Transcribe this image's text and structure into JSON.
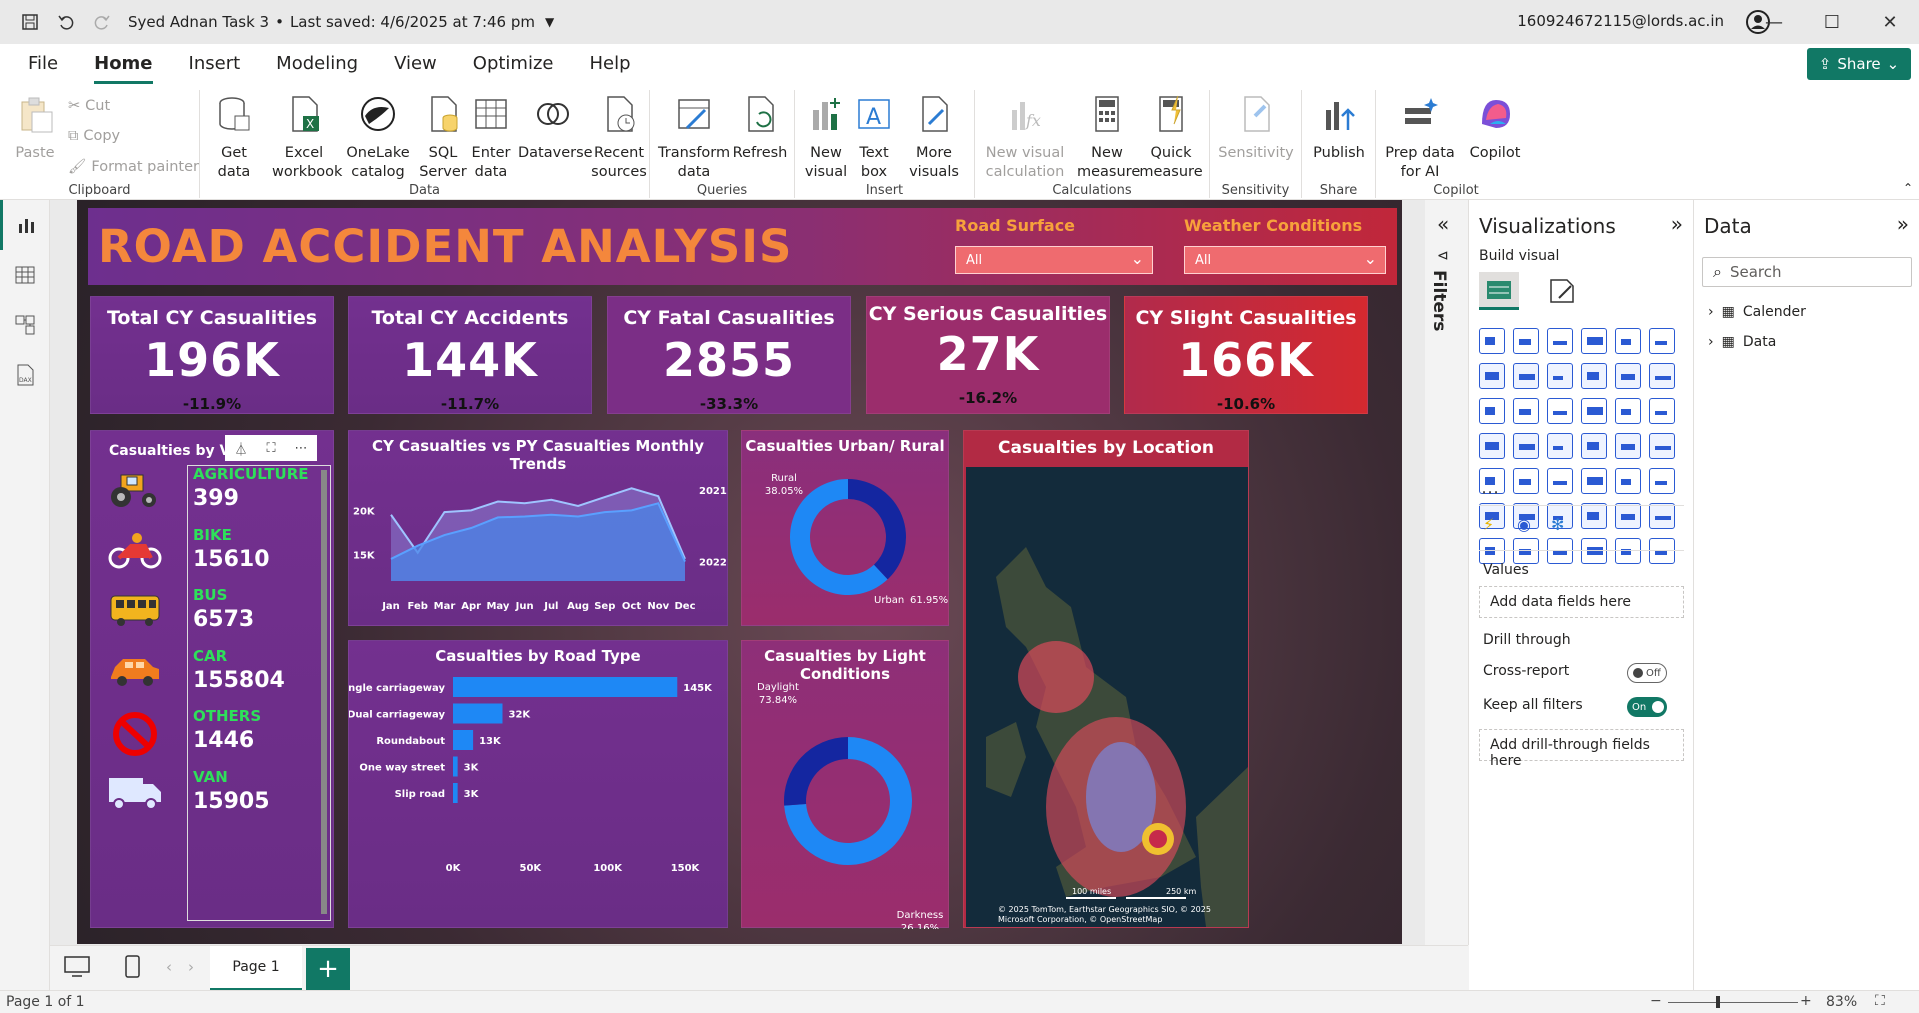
{
  "titlebar": {
    "doc_title": "Syed Adnan Task 3",
    "saved": "Last saved: 4/6/2025 at 7:46 pm",
    "account": "160924672115@lords.ac.in"
  },
  "menu": [
    "File",
    "Home",
    "Insert",
    "Modeling",
    "View",
    "Optimize",
    "Help"
  ],
  "share_label": "Share",
  "ribbon": {
    "clipboard": {
      "paste": "Paste",
      "cut": "Cut",
      "copy": "Copy",
      "format_painter": "Format painter",
      "label": "Clipboard"
    },
    "data": {
      "get_data": "Get data",
      "excel": "Excel workbook",
      "onelake": "OneLake catalog",
      "sql": "SQL Server",
      "enter": "Enter data",
      "dataverse": "Dataverse",
      "recent": "Recent sources",
      "label": "Data"
    },
    "queries": {
      "transform": "Transform data",
      "refresh": "Refresh",
      "label": "Queries"
    },
    "insert": {
      "new_visual": "New visual",
      "text_box": "Text box",
      "more_visuals": "More visuals",
      "label": "Insert"
    },
    "calculations": {
      "new_visual_calc": "New visual calculation",
      "new_measure": "New measure",
      "quick_measure": "Quick measure",
      "label": "Calculations"
    },
    "sensitivity": {
      "sensitivity": "Sensitivity",
      "label": "Sensitivity"
    },
    "share": {
      "publish": "Publish",
      "label": "Share"
    },
    "copilot": {
      "prep": "Prep data for AI",
      "copilot": "Copilot",
      "label": "Copilot"
    }
  },
  "report": {
    "title": "ROAD ACCIDENT ANALYSIS",
    "slicers": [
      {
        "label": "Road Surface",
        "value": "All"
      },
      {
        "label": "Weather Conditions",
        "value": "All"
      }
    ],
    "kpis": [
      {
        "label": "Total CY Casualities",
        "value": "196K",
        "change": "-11.9%"
      },
      {
        "label": "Total CY Accidents",
        "value": "144K",
        "change": "-11.7%"
      },
      {
        "label": "CY Fatal Casualities",
        "value": "2855",
        "change": "-33.3%"
      },
      {
        "label": "CY Serious Casualities",
        "value": "27K",
        "change": "-16.2%"
      },
      {
        "label": "CY Slight Casualities",
        "value": "166K",
        "change": "-10.6%"
      }
    ],
    "vehicles": {
      "title": "Casualties by Ve",
      "items": [
        {
          "name": "AGRICULTURE",
          "value": "399",
          "icon": "tractor-icon"
        },
        {
          "name": "BIKE",
          "value": "15610",
          "icon": "motorbike-icon"
        },
        {
          "name": "BUS",
          "value": "6573",
          "icon": "bus-icon"
        },
        {
          "name": "CAR",
          "value": "155804",
          "icon": "car-icon"
        },
        {
          "name": "OTHERS",
          "value": "1446",
          "icon": "no-entry-icon"
        },
        {
          "name": "VAN",
          "value": "15905",
          "icon": "van-icon"
        }
      ]
    },
    "map": {
      "title": "Casualties by Location",
      "scale1": "100 miles",
      "scale2": "250 km",
      "credit": "© 2025 TomTom, Earthstar Geographics SIO, © 2025 Microsoft Corporation, © OpenStreetMap"
    }
  },
  "chart_data": [
    {
      "type": "area",
      "title": "CY Casualties vs PY Casualties Monthly Trends",
      "categories": [
        "Jan",
        "Feb",
        "Mar",
        "Apr",
        "May",
        "Jun",
        "Jul",
        "Aug",
        "Sep",
        "Oct",
        "Nov",
        "Dec"
      ],
      "series": [
        {
          "name": "2021",
          "values": [
            19500,
            15200,
            19800,
            20000,
            21000,
            20800,
            21200,
            20500,
            21500,
            22500,
            21600,
            14500
          ]
        },
        {
          "name": "2022",
          "values": [
            14500,
            16000,
            17200,
            18000,
            19200,
            19300,
            19500,
            19300,
            19800,
            20000,
            20800,
            14200
          ]
        }
      ],
      "yticks": [
        "15K",
        "20K"
      ],
      "ylim": [
        12000,
        24000
      ],
      "colors": {
        "2021": "#8a7fd6",
        "2022": "#4a86e8"
      }
    },
    {
      "type": "pie",
      "title": "Casualties Urban/ Rural",
      "slices": [
        {
          "name": "Rural",
          "value": 38.05,
          "label": "38.05%",
          "color": "#1426a0"
        },
        {
          "name": "Urban",
          "value": 61.95,
          "label": "61.95%",
          "color": "#1e88f5"
        }
      ]
    },
    {
      "type": "bar",
      "title": "Casualties by Road Type",
      "categories": [
        "Single carriageway",
        "Dual carriageway",
        "Roundabout",
        "One way street",
        "Slip road"
      ],
      "values": [
        145000,
        32000,
        13000,
        3000,
        3000
      ],
      "labels": [
        "145K",
        "32K",
        "13K",
        "3K",
        "3K"
      ],
      "xticks": [
        "0K",
        "50K",
        "100K",
        "150K"
      ],
      "xlim": [
        0,
        150000
      ],
      "color": "#1e88f5"
    },
    {
      "type": "pie",
      "title": "Casualties by Light Conditions",
      "slices": [
        {
          "name": "Daylight",
          "value": 73.84,
          "label": "73.84%",
          "color": "#1e88f5"
        },
        {
          "name": "Darkness",
          "value": 26.16,
          "label": "26.16%",
          "color": "#1426a0"
        }
      ]
    }
  ],
  "filters_label": "Filters",
  "viz_pane": {
    "title": "Visualizations",
    "build": "Build visual",
    "values": "Values",
    "add_fields": "Add data fields here",
    "drill": "Drill through",
    "cross": "Cross-report",
    "cross_state": "Off",
    "keep": "Keep all filters",
    "keep_state": "On",
    "add_drill": "Add drill-through fields here"
  },
  "data_pane": {
    "title": "Data",
    "search": "Search",
    "tables": [
      "Calender",
      "Data"
    ]
  },
  "pages": {
    "page1": "Page 1"
  },
  "status": {
    "page": "Page 1 of 1",
    "zoom": "83%"
  }
}
